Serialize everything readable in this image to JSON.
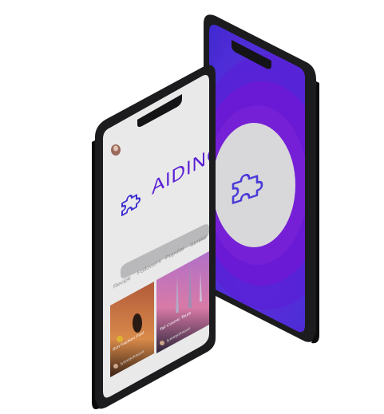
{
  "app": {
    "logo_text": "AIDING",
    "brand_purple": "#6a1fd6",
    "brand_blue": "#3d2fd0",
    "screen_bg": "#e9e9ea"
  },
  "profile": {
    "avatar": "avatar-photo"
  },
  "tabs": [
    {
      "label": "Recipe"
    },
    {
      "label": "Followers"
    },
    {
      "label": "Popular"
    },
    {
      "label": "Similar"
    }
  ],
  "cards": [
    {
      "caption": "Sun Fashion Fuel",
      "author": "lynnejohnson"
    },
    {
      "caption": "Tall Cosmic Tours",
      "author": "lynnejohnson"
    }
  ],
  "splash": {
    "icon": "puzzle-icon",
    "ring_colors": [
      "#4a2fd8",
      "#5a1fd9",
      "#6a1ad6",
      "#7a1fd8"
    ],
    "center_color": "#d8d8da"
  }
}
